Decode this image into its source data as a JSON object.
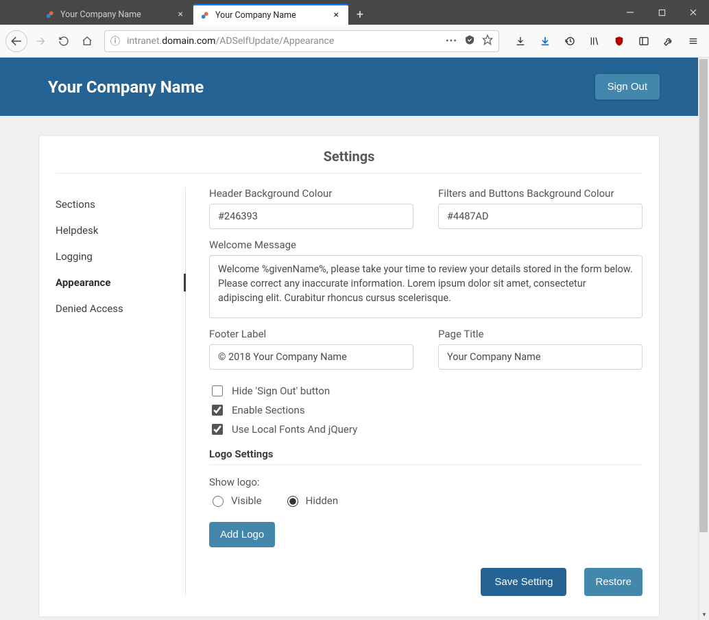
{
  "browser": {
    "tabs": [
      {
        "title": "Your Company Name",
        "active": false
      },
      {
        "title": "Your Company Name",
        "active": true
      }
    ],
    "url_pre": "intranet.",
    "url_host": "domain.com",
    "url_path": "/ADSelfUpdate/Appearance"
  },
  "header": {
    "company": "Your Company Name",
    "signout": "Sign Out"
  },
  "settings": {
    "title": "Settings",
    "nav": {
      "sections": "Sections",
      "helpdesk": "Helpdesk",
      "logging": "Logging",
      "appearance": "Appearance",
      "denied": "Denied Access"
    },
    "form": {
      "header_bg_label": "Header Background Colour",
      "header_bg_value": "#246393",
      "filters_bg_label": "Filters and Buttons Background Colour",
      "filters_bg_value": "#4487AD",
      "welcome_label": "Welcome Message",
      "welcome_value": "Welcome %givenName%, please take your time to review your details stored in the form below. Please correct any inaccurate information. Lorem ipsum dolor sit amet, consectetur adipiscing elit. Curabitur rhoncus cursus scelerisque.",
      "footer_label_label": "Footer Label",
      "footer_label_value": "© 2018 Your Company Name",
      "page_title_label": "Page Title",
      "page_title_value": "Your Company Name",
      "hide_signout_label": "Hide 'Sign Out' button",
      "enable_sections_label": "Enable Sections",
      "use_local_fonts_label": "Use Local Fonts And jQuery",
      "logo_section": "Logo Settings",
      "show_logo_label": "Show logo:",
      "visible_label": "Visible",
      "hidden_label": "Hidden",
      "add_logo": "Add Logo",
      "save": "Save Setting",
      "restore": "Restore"
    }
  }
}
